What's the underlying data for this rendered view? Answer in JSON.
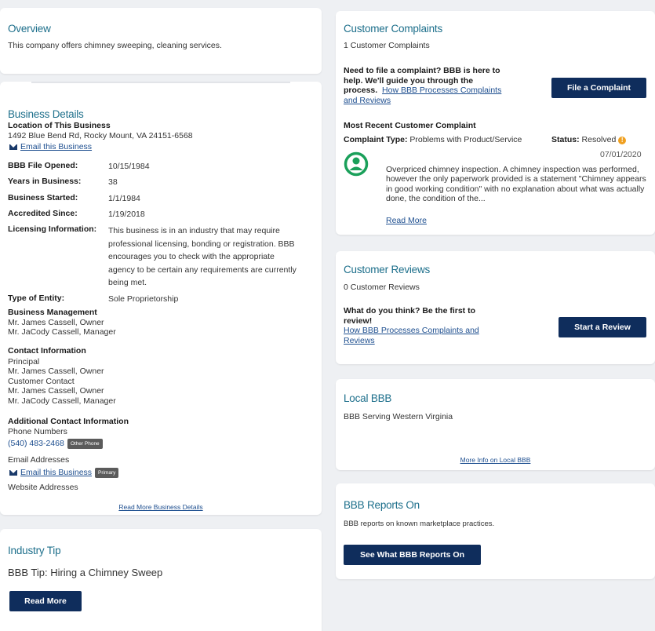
{
  "overview": {
    "title": "Overview",
    "text": "This company offers chimney sweeping, cleaning services."
  },
  "business_details": {
    "title": "Business Details",
    "location_label": "Location of This Business",
    "address": "1492 Blue Bend Rd, Rocky Mount, VA 24151-6568",
    "email_link": "Email this Business",
    "rows": [
      {
        "key": "BBB File Opened:",
        "value": "10/15/1984"
      },
      {
        "key": "Years in Business:",
        "value": "38"
      },
      {
        "key": "Business Started:",
        "value": "1/1/1984"
      },
      {
        "key": "Accredited Since:",
        "value": "1/19/2018"
      },
      {
        "key": "Licensing Information:",
        "value": "This business is in an industry that may require professional licensing, bonding or registration. BBB encourages you to check with the appropriate agency to be certain any requirements are currently being met."
      },
      {
        "key": "Type of Entity:",
        "value": "Sole Proprietorship"
      }
    ],
    "management_label": "Business Management",
    "management": [
      "Mr. James Cassell, Owner",
      "Mr. JaCody Cassell, Manager"
    ],
    "contact_label": "Contact Information",
    "contact_lines": [
      "Principal",
      "Mr. James Cassell, Owner",
      "Customer Contact",
      "Mr. James Cassell, Owner",
      "Mr. JaCody Cassell, Manager"
    ],
    "additional_label": "Additional Contact Information",
    "phone_numbers_label": "Phone Numbers",
    "phone": "(540) 483-2468",
    "phone_badge": "Other Phone",
    "email_addresses_label": "Email Addresses",
    "email_link2": "Email this Business",
    "email_badge": "Primary",
    "website_label": "Website Addresses",
    "read_more": "Read More Business Details"
  },
  "industry_tip": {
    "title": "Industry Tip",
    "text": "BBB Tip: Hiring a Chimney Sweep",
    "button": "Read More"
  },
  "complaints": {
    "title": "Customer Complaints",
    "count": "1 Customer Complaints",
    "prompt_line1": "Need to file a complaint? BBB is here to",
    "prompt_line2": "help. We'll guide you through the",
    "prompt_line3": "process.",
    "process_link_part1": "How BBB Processes Complaints",
    "process_link_part2": "and Reviews",
    "file_button": "File a Complaint",
    "recent_label": "Most Recent Customer Complaint",
    "type_label": "Complaint Type:",
    "type_value": "Problems with Product/Service",
    "status_label": "Status:",
    "status_value": "Resolved",
    "date": "07/01/2020",
    "body": "Overpriced chimney inspection. A chimney inspection was performed, however the only paperwork provided is a statement \"Chimney appears in good working condition\" with no explanation about what was actually done, the condition of the...",
    "read_more": "Read More"
  },
  "reviews": {
    "title": "Customer Reviews",
    "count": "0 Customer Reviews",
    "prompt_line1": "What do you think? Be the first to",
    "prompt_line2": "review!",
    "process_link_part1": "How BBB Processes Complaints and",
    "process_link_part2": "Reviews",
    "start_button": "Start a Review"
  },
  "local_bbb": {
    "title": "Local BBB",
    "text": "BBB Serving Western Virginia",
    "more_link": "More Info on Local BBB"
  },
  "reports": {
    "title": "BBB Reports On",
    "text": "BBB reports on known marketplace practices.",
    "button": "See What BBB Reports On"
  },
  "colors": {
    "heading": "#1d6f8b",
    "button": "#0f2d5c",
    "avatar": "#1aa05a",
    "status_icon": "#f0a020"
  }
}
